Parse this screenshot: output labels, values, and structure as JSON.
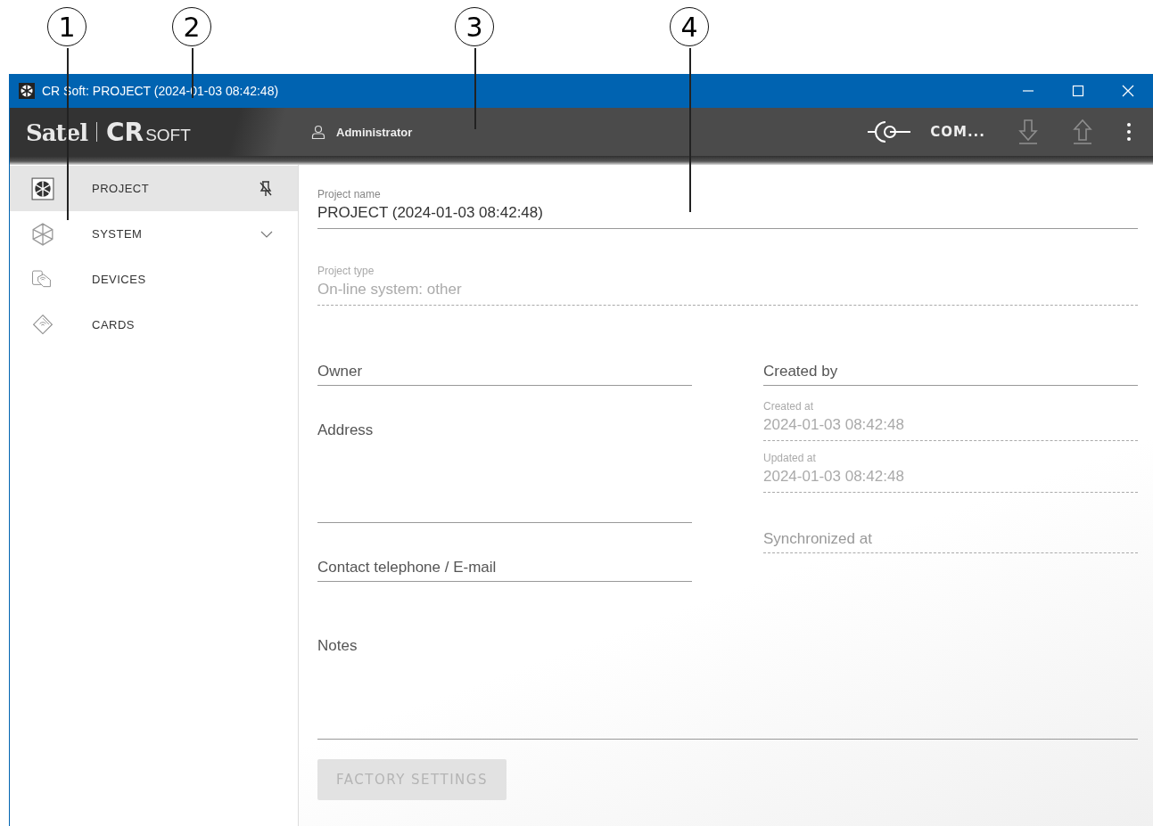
{
  "callouts": [
    {
      "number": "1"
    },
    {
      "number": "2"
    },
    {
      "number": "3"
    },
    {
      "number": "4"
    }
  ],
  "window": {
    "title": "CR Soft: PROJECT (2024-01-03 08:42:48)"
  },
  "header": {
    "logo": {
      "brand": "Satel",
      "product": "CR",
      "product_suffix": "SOFT"
    },
    "user": "Administrator",
    "connection": "COM...",
    "download_disabled": true,
    "upload_disabled": true
  },
  "sidebar": {
    "pinned": false,
    "items": [
      {
        "label": "PROJECT",
        "selected": true
      },
      {
        "label": "SYSTEM",
        "selected": false,
        "expanded": false
      },
      {
        "label": "DEVICES",
        "selected": false
      },
      {
        "label": "CARDS",
        "selected": false
      }
    ]
  },
  "form": {
    "project_name": {
      "label": "Project name",
      "value": "PROJECT (2024-01-03 08:42:48)",
      "disabled": false
    },
    "project_type": {
      "label": "Project type",
      "value": "On-line system: other",
      "disabled": true
    },
    "left": [
      {
        "label": "Owner",
        "disabled": false,
        "multiline": false
      },
      {
        "label": "Address",
        "disabled": false,
        "multiline": true
      },
      {
        "label": "Contact telephone / E-mail",
        "disabled": false,
        "multiline": false
      }
    ],
    "right": [
      {
        "label": "Created by",
        "disabled": false
      },
      {
        "label": "Created at",
        "value": "2024-01-03 08:42:48",
        "disabled": true
      },
      {
        "label": "Updated at",
        "value": "2024-01-03 08:42:48",
        "disabled": true
      },
      {
        "label": "Synchronized at",
        "disabled": true
      }
    ],
    "notes": {
      "label": "Notes",
      "disabled": false
    },
    "factory_button": {
      "label": "FACTORY SETTINGS",
      "disabled": true
    }
  }
}
